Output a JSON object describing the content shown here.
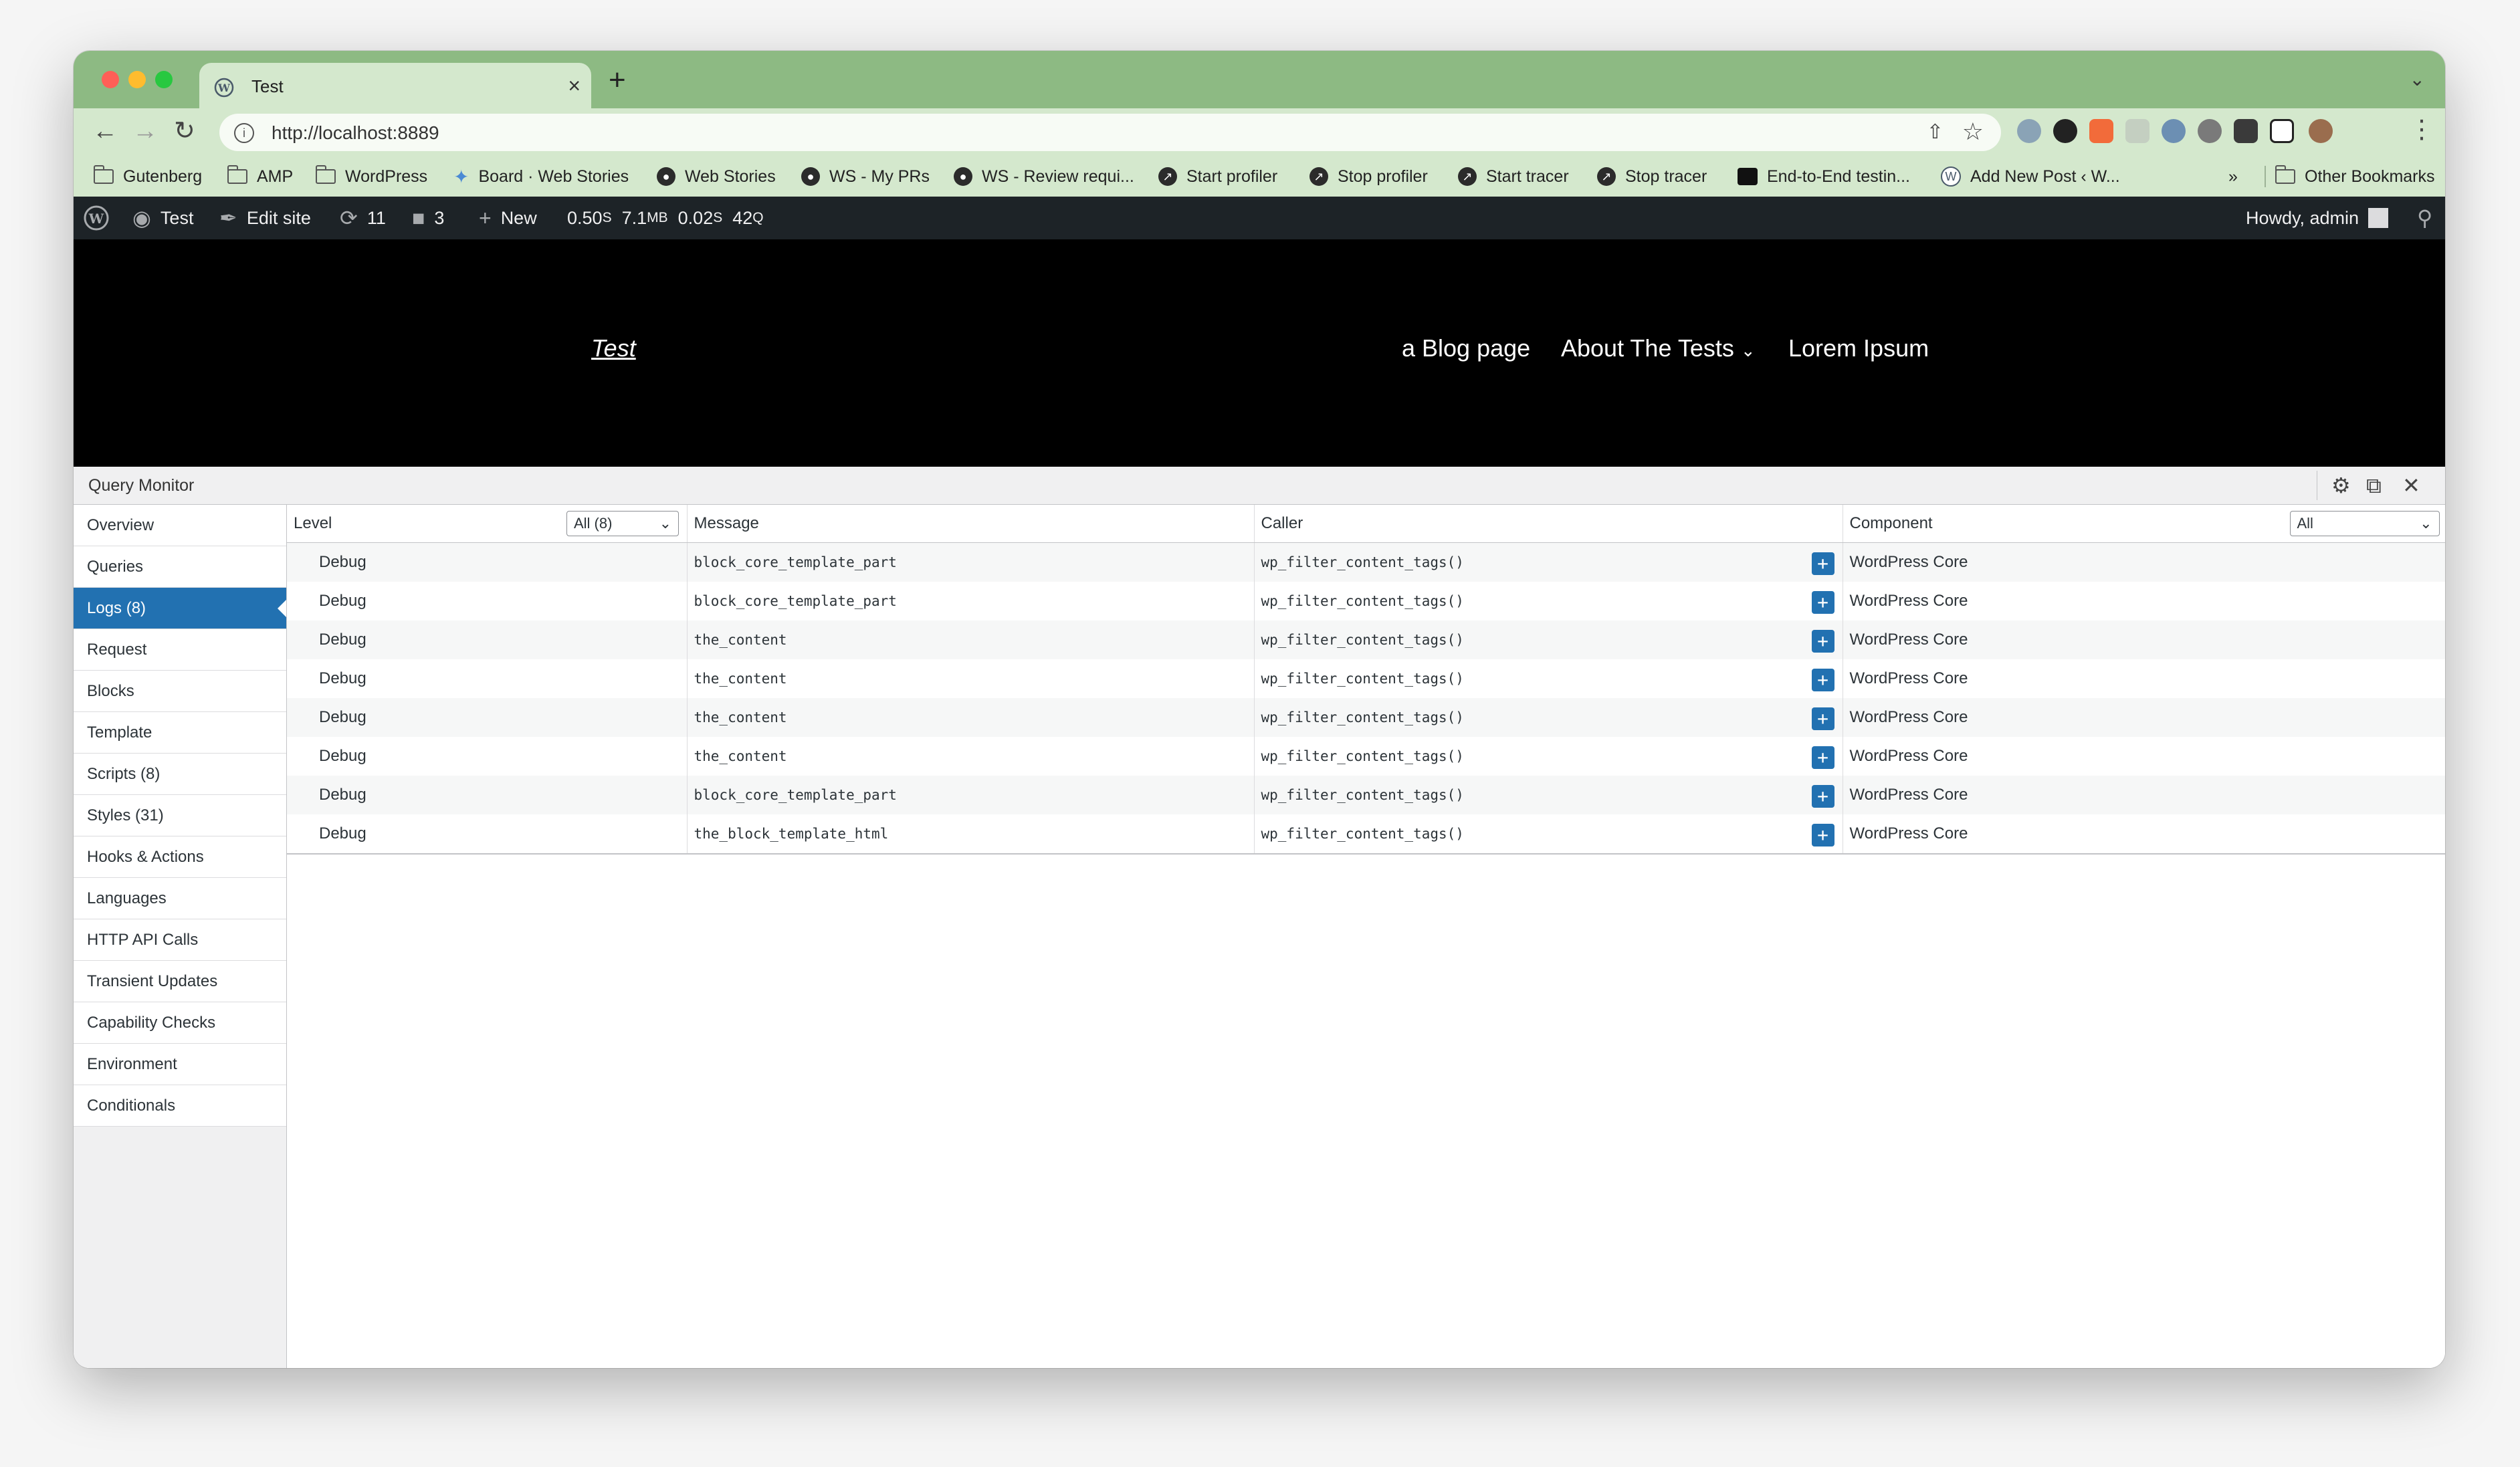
{
  "browser": {
    "tab_title": "Test",
    "tab_close": "×",
    "new_tab": "+",
    "url": "http://localhost:8889",
    "bookmarks": [
      {
        "label": "Gutenberg",
        "icon": "folder-icon"
      },
      {
        "label": "AMP",
        "icon": "folder-icon"
      },
      {
        "label": "WordPress",
        "icon": "folder-icon"
      },
      {
        "label": "Board · Web Stories",
        "icon": "board-icon"
      },
      {
        "label": "Web Stories",
        "icon": "github-icon"
      },
      {
        "label": "WS - My PRs",
        "icon": "github-icon"
      },
      {
        "label": "WS - Review requi...",
        "icon": "github-icon"
      },
      {
        "label": "Start profiler",
        "icon": "bookmarklet-icon"
      },
      {
        "label": "Stop profiler",
        "icon": "bookmarklet-icon"
      },
      {
        "label": "Start tracer",
        "icon": "bookmarklet-icon"
      },
      {
        "label": "Stop tracer",
        "icon": "bookmarklet-icon"
      },
      {
        "label": "End-to-End testin...",
        "icon": "e2e-icon"
      },
      {
        "label": "Add New Post ‹ W...",
        "icon": "wordpress-icon"
      }
    ],
    "more_bookmarks": "»",
    "other_bookmarks": "Other Bookmarks"
  },
  "adminbar": {
    "site_name": "Test",
    "edit_site": "Edit site",
    "updates_count": "11",
    "comments_count": "3",
    "new_label": "New",
    "perf_time": "0.50",
    "perf_time_unit": "S",
    "perf_mem": "7.1",
    "perf_mem_unit": "MB",
    "perf_db_time": "0.02",
    "perf_db_unit": "S",
    "perf_queries": "42",
    "perf_queries_unit": "Q",
    "howdy": "Howdy, admin"
  },
  "site": {
    "title": "Test",
    "nav": [
      "a Blog page",
      "About The Tests",
      "Lorem Ipsum"
    ],
    "submenu_indicator": "⌄"
  },
  "qm": {
    "title": "Query Monitor",
    "nav": [
      {
        "label": "Overview",
        "active": false
      },
      {
        "label": "Queries",
        "active": false
      },
      {
        "label": "Logs (8)",
        "active": true
      },
      {
        "label": "Request",
        "active": false
      },
      {
        "label": "Blocks",
        "active": false
      },
      {
        "label": "Template",
        "active": false
      },
      {
        "label": "Scripts (8)",
        "active": false
      },
      {
        "label": "Styles (31)",
        "active": false
      },
      {
        "label": "Hooks & Actions",
        "active": false
      },
      {
        "label": "Languages",
        "active": false
      },
      {
        "label": "HTTP API Calls",
        "active": false
      },
      {
        "label": "Transient Updates",
        "active": false
      },
      {
        "label": "Capability Checks",
        "active": false
      },
      {
        "label": "Environment",
        "active": false
      },
      {
        "label": "Conditionals",
        "active": false
      }
    ],
    "columns": {
      "level": "Level",
      "message": "Message",
      "caller": "Caller",
      "component": "Component"
    },
    "level_filter": "All (8)",
    "component_filter": "All",
    "expand_label": "+",
    "rows": [
      {
        "level": "Debug",
        "message": "block_core_template_part",
        "caller": "wp_filter_content_tags()",
        "component": "WordPress Core"
      },
      {
        "level": "Debug",
        "message": "block_core_template_part",
        "caller": "wp_filter_content_tags()",
        "component": "WordPress Core"
      },
      {
        "level": "Debug",
        "message": "the_content",
        "caller": "wp_filter_content_tags()",
        "component": "WordPress Core"
      },
      {
        "level": "Debug",
        "message": "the_content",
        "caller": "wp_filter_content_tags()",
        "component": "WordPress Core"
      },
      {
        "level": "Debug",
        "message": "the_content",
        "caller": "wp_filter_content_tags()",
        "component": "WordPress Core"
      },
      {
        "level": "Debug",
        "message": "the_content",
        "caller": "wp_filter_content_tags()",
        "component": "WordPress Core"
      },
      {
        "level": "Debug",
        "message": "block_core_template_part",
        "caller": "wp_filter_content_tags()",
        "component": "WordPress Core"
      },
      {
        "level": "Debug",
        "message": "the_block_template_html",
        "caller": "wp_filter_content_tags()",
        "component": "WordPress Core"
      }
    ]
  },
  "colors": {
    "tabstrip": "#8dba83",
    "toolbar": "#d4e8cd",
    "adminbar": "#1d2327",
    "accent": "#2271b1"
  }
}
